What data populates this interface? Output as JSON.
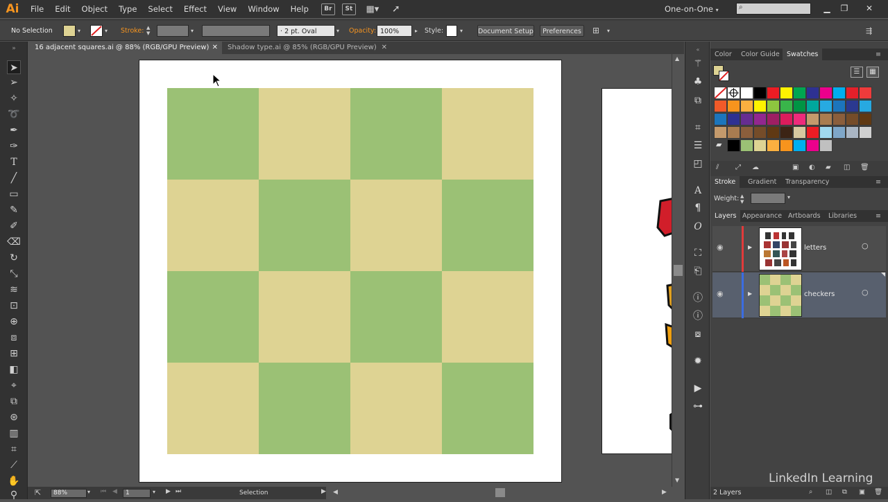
{
  "app": {
    "logo": "Ai",
    "workspace": "One-on-One"
  },
  "menu": [
    "File",
    "Edit",
    "Object",
    "Type",
    "Select",
    "Effect",
    "View",
    "Window",
    "Help"
  ],
  "menubar_buttons": {
    "br": "Br",
    "st": "St"
  },
  "control": {
    "selection_status": "No Selection",
    "stroke_label": "Stroke:",
    "brush_value": "2 pt. Oval",
    "opacity_label": "Opacity:",
    "opacity_value": "100%",
    "style_label": "Style:",
    "document_setup": "Document Setup",
    "preferences": "Preferences"
  },
  "tabs": [
    {
      "label": "16 adjacent squares.ai @ 88% (RGB/GPU Preview)",
      "active": true
    },
    {
      "label": "Shadow type.ai @ 85% (RGB/GPU Preview)",
      "active": false
    }
  ],
  "status": {
    "zoom": "88%",
    "artboard": "1",
    "tool": "Selection"
  },
  "colors": {
    "green": "#9bc175",
    "tan": "#ded393",
    "accent": "#f79520"
  },
  "panels": {
    "color_tabs": [
      "Color",
      "Color Guide",
      "Swatches"
    ],
    "stroke_tabs": [
      "Stroke",
      "Gradient",
      "Transparency"
    ],
    "weight_label": "Weight:",
    "layers_tabs": [
      "Layers",
      "Appearance",
      "Artboards",
      "Libraries"
    ],
    "layers": [
      {
        "name": "letters",
        "color": "#e23b3b"
      },
      {
        "name": "checkers",
        "color": "#3b6de2"
      }
    ],
    "layers_count": "2 Layers"
  },
  "watermark": "LinkedIn Learning"
}
